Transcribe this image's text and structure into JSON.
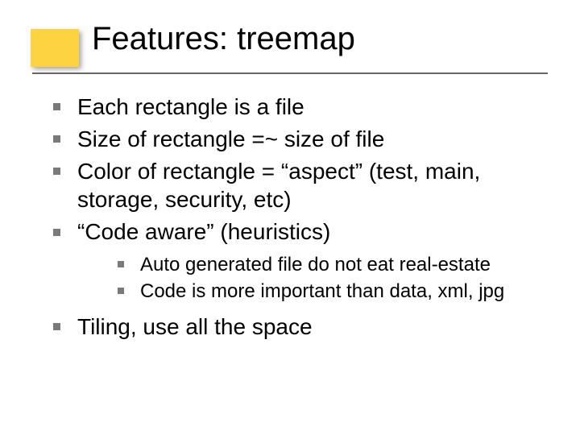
{
  "title": "Features: treemap",
  "bullets": [
    "Each rectangle is a file",
    "Size of rectangle =~ size of file",
    "Color of rectangle = “aspect” (test, main, storage, security, etc)",
    "“Code aware” (heuristics)",
    "Tiling, use all the space"
  ],
  "sub_bullets": [
    "Auto generated file do not eat real-estate",
    "Code is more important than data, xml, jpg"
  ]
}
